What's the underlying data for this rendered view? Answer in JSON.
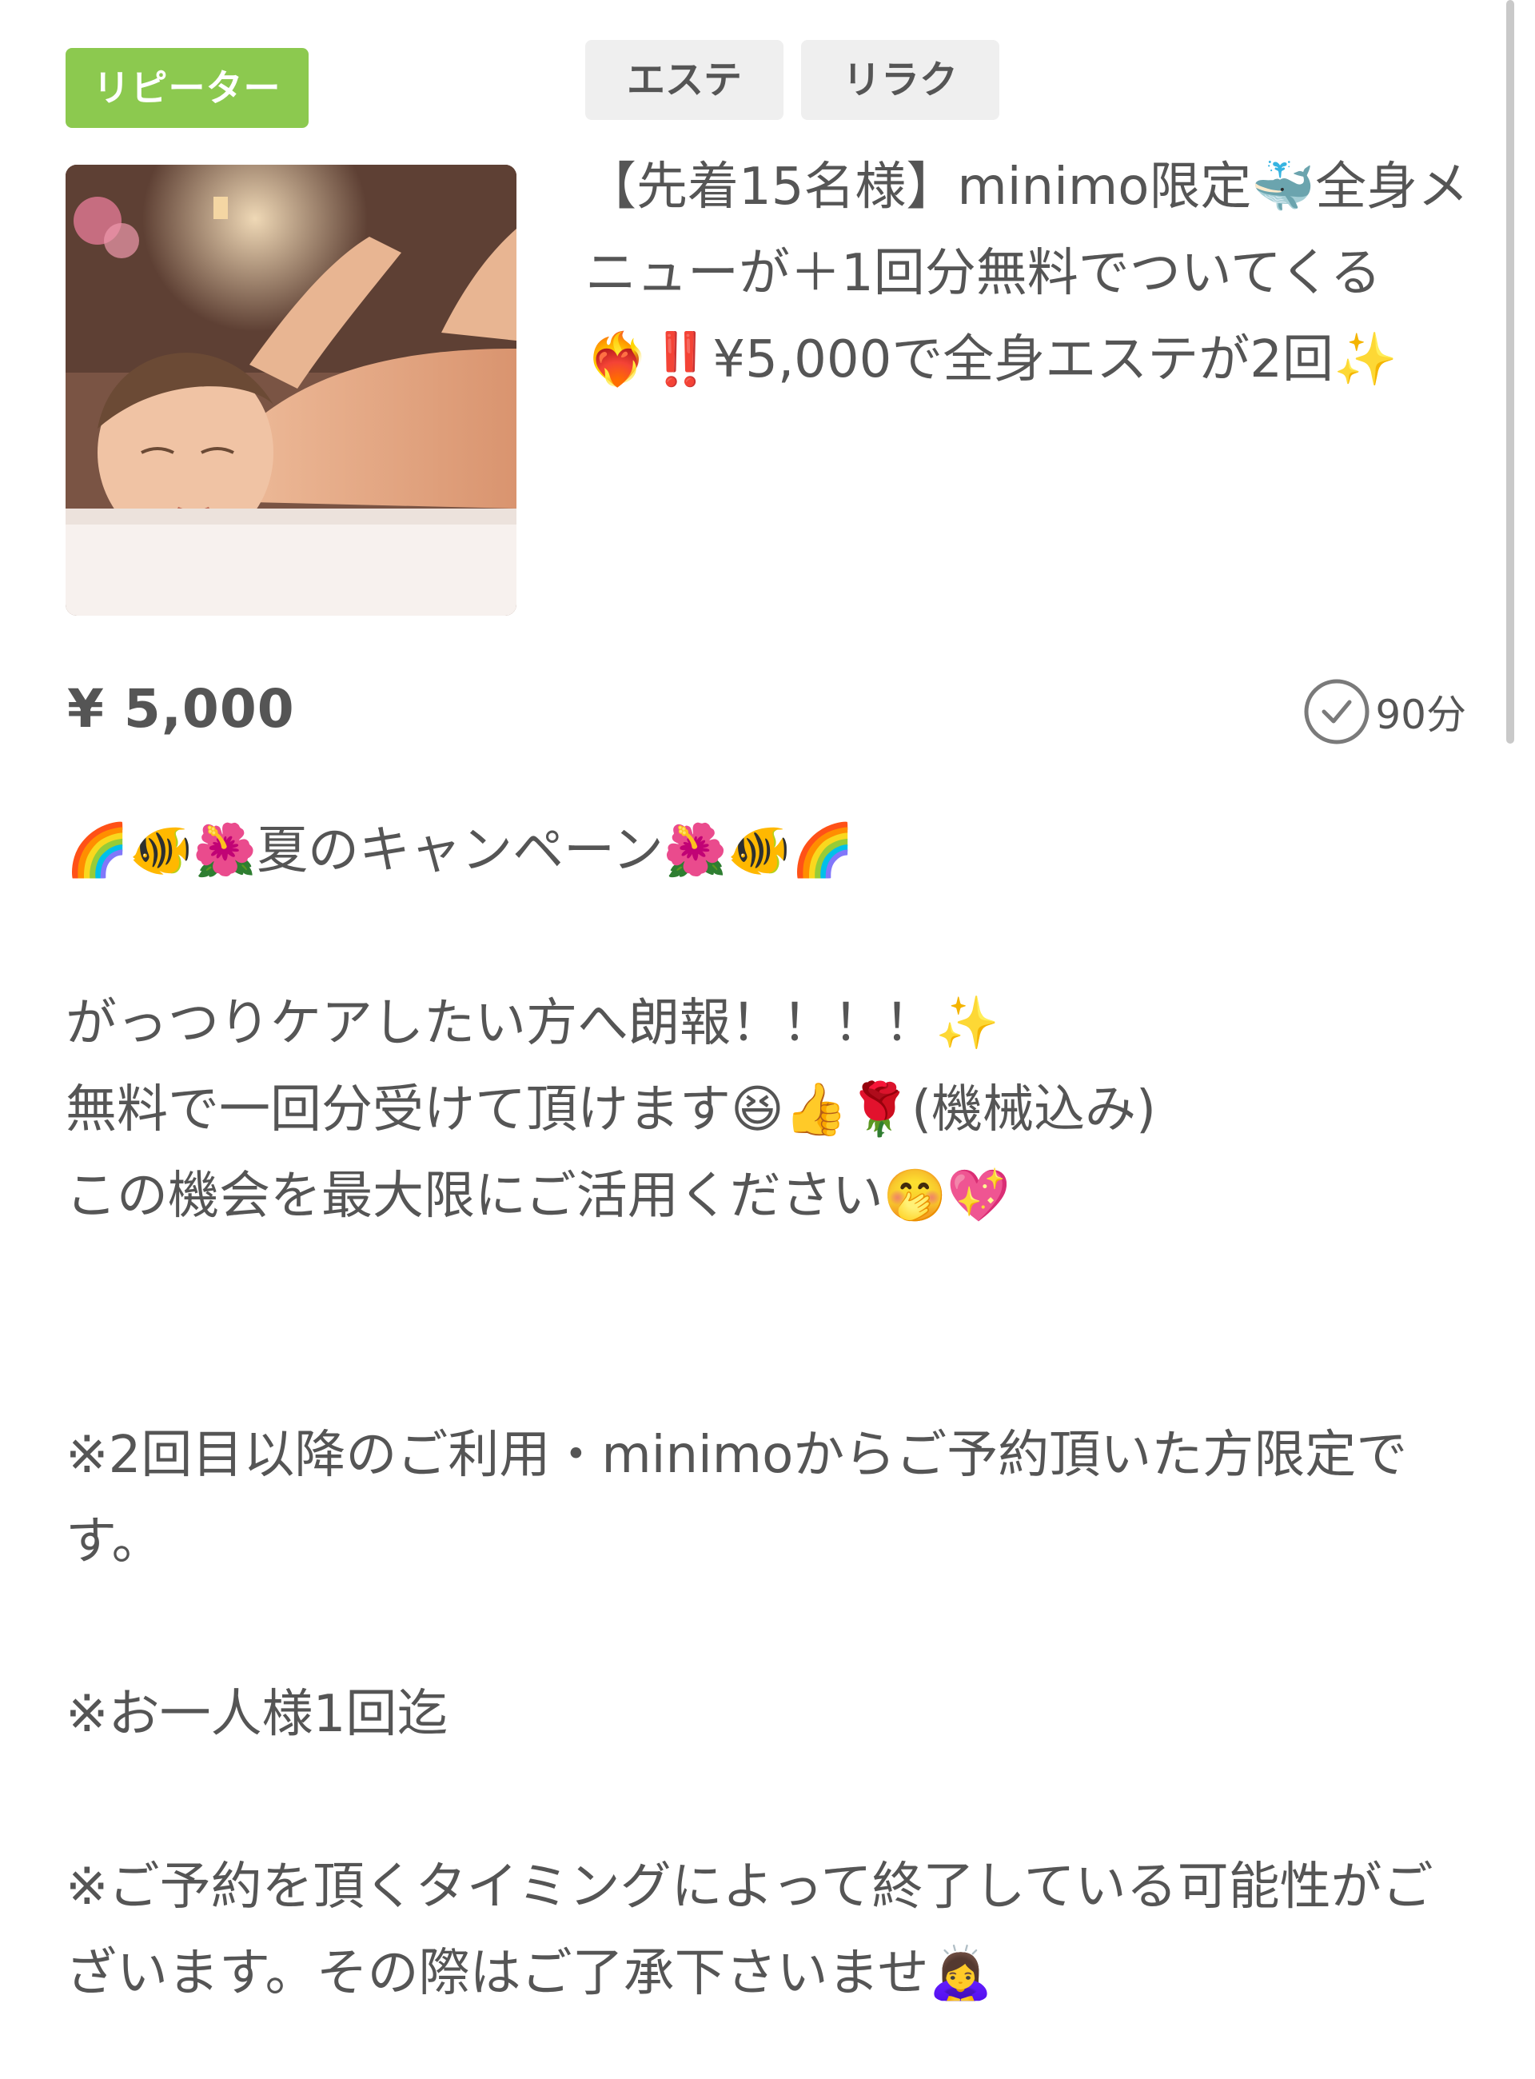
{
  "badge": {
    "label": "リピーター"
  },
  "tags": [
    "エステ",
    "リラク"
  ],
  "title": "【先着15名様】minimo限定🐳全身メニューが＋1回分無料でついてくる❤️‍🔥‼️¥5,000で全身エステが2回✨",
  "price": "¥ 5,000",
  "duration": "90分",
  "description": {
    "headline": "🌈🐠🌺夏のキャンペーン🌺🐠🌈",
    "line1": "がっつりケアしたい方へ朗報！！！！✨",
    "line2": "無料で一回分受けて頂けます😆👍🌹(機械込み)",
    "line3": "この機会を最大限にご活用ください🤭💖",
    "note1": "※2回目以降のご利用・minimoからご予約頂いた方限定です。",
    "note2": "※お一人様1回迄",
    "note3": "※ご予約を頂くタイミングによって終了している可能性がございます。その際はご了承下さいませ🙇‍♀️"
  },
  "colors": {
    "badge_green": "#8cc94f",
    "tag_bg": "#efefef",
    "text": "#555555"
  },
  "icons": {
    "clock": "clock-icon",
    "thumbnail": "massage-photo"
  }
}
